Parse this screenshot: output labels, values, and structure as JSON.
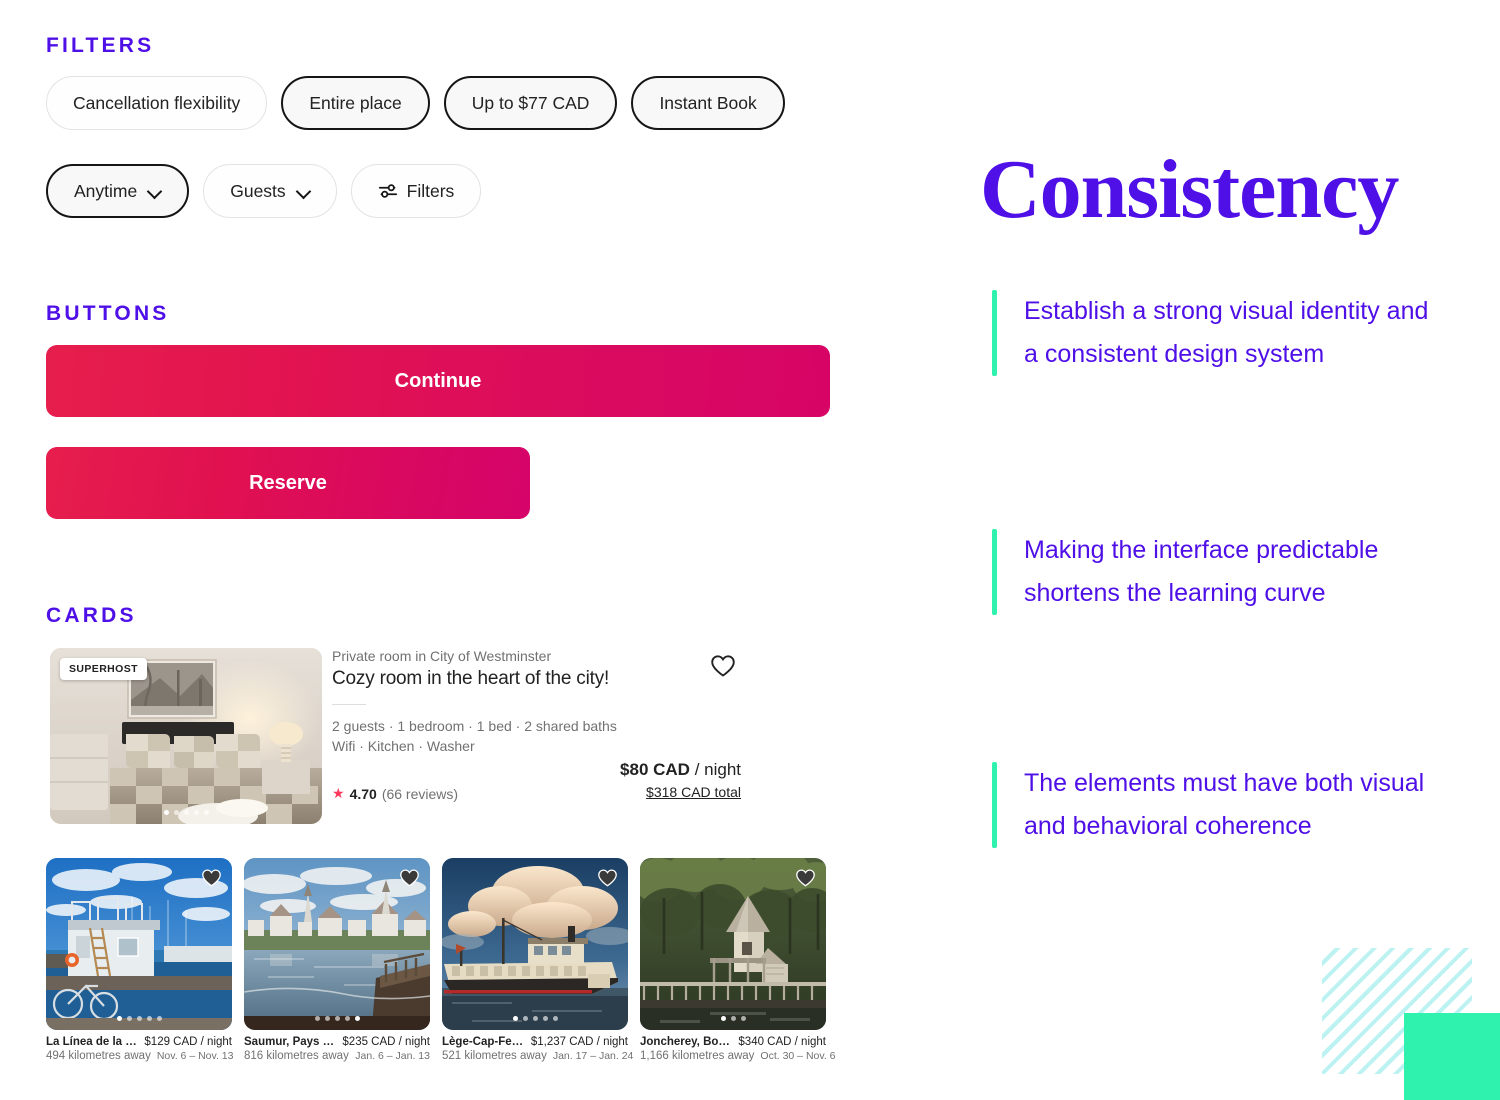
{
  "sections": {
    "filters_heading": "FILTERS",
    "buttons_heading": "BUTTONS",
    "cards_heading": "CARDS"
  },
  "filters": {
    "row1": [
      {
        "label": "Cancellation flexibility",
        "selected": false
      },
      {
        "label": "Entire place",
        "selected": true
      },
      {
        "label": "Up to $77 CAD",
        "selected": true
      },
      {
        "label": "Instant Book",
        "selected": true
      }
    ],
    "row2": [
      {
        "label": "Anytime",
        "selected": true,
        "icon": "chevron-down-icon"
      },
      {
        "label": "Guests",
        "selected": false,
        "icon": "chevron-down-icon"
      },
      {
        "label": "Filters",
        "selected": false,
        "icon": "tune-icon"
      }
    ]
  },
  "buttons": {
    "continue_label": "Continue",
    "reserve_label": "Reserve"
  },
  "big_card": {
    "badge": "SUPERHOST",
    "subtitle": "Private room in City of Westminster",
    "title": "Cozy room in the heart of the city!",
    "meta_line_1": "2 guests · 1 bedroom · 1 bed · 2 shared baths",
    "meta_line_2": "Wifi · Kitchen · Washer",
    "rating_value": "4.70",
    "rating_reviews": "(66 reviews)",
    "price": "$80 CAD",
    "price_unit": "/ night",
    "price_total": "$318 CAD total",
    "photo_dots": 5,
    "photo_active_dot": 0,
    "heart": "heart-outline-icon"
  },
  "small_cards": [
    {
      "location": "La Línea de la Con...",
      "price": "$129 CAD / night",
      "distance": "494 kilometres away",
      "dates": "Nov. 6 – Nov. 13",
      "dots": 5,
      "active_dot": 0
    },
    {
      "location": "Saumur, Pays de l...",
      "price": "$235 CAD / night",
      "distance": "816 kilometres away",
      "dates": "Jan. 6 – Jan. 13",
      "dots": 5,
      "active_dot": 4
    },
    {
      "location": "Lège-Cap-Ferret",
      "price": "$1,237 CAD / night",
      "distance": "521 kilometres away",
      "dates": "Jan. 17 – Jan. 24",
      "dots": 5,
      "active_dot": 0
    },
    {
      "location": "Joncherey, Bourg...",
      "price": "$340 CAD / night",
      "distance": "1,166 kilometres away",
      "dates": "Oct. 30 – Nov. 6",
      "dots": 3,
      "active_dot": 0
    }
  ],
  "right_panel": {
    "title": "Consistency",
    "bullets": [
      "Establish a strong visual identity and a consistent design system",
      "Making the interface predictable shortens the learning curve",
      "The elements must have both visual and behavioral coherence"
    ]
  },
  "colors": {
    "accent_purple": "#4F10E8",
    "accent_mint": "#2EF2AD",
    "accent_mint_light": "#BDF2F2",
    "cta_gradient_start": "#E61E4D",
    "cta_gradient_end": "#D70466",
    "star_pink": "#FF385C"
  }
}
